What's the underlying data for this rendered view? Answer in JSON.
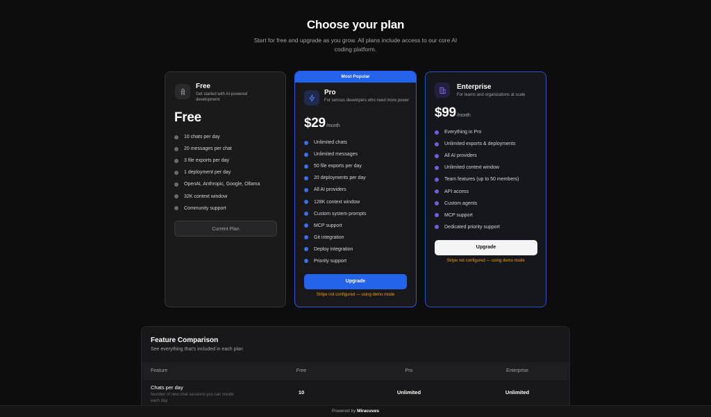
{
  "header": {
    "title": "Choose your plan",
    "subtitle": "Start for free and upgrade as you grow. All plans include access to our core AI coding platform."
  },
  "colors": {
    "accent": "#2563eb",
    "enterprise_accent": "#6d5ce7",
    "warning": "#f59e0b",
    "background": "#0d0d0d"
  },
  "plans": {
    "free": {
      "icon": "rocket-icon",
      "name": "Free",
      "description": "Get started with AI-powered development",
      "price": "Free",
      "features": [
        "10 chats per day",
        "20 messages per chat",
        "3 file exports per day",
        "1 deployment per day",
        "OpenAI, Anthropic, Google, Ollama",
        "32K context window",
        "Community support"
      ],
      "button": "Current Plan"
    },
    "pro": {
      "badge": "Most Popular",
      "icon": "lightning-icon",
      "name": "Pro",
      "description": "For serious developers who need more power",
      "price": "$29",
      "period": "/month",
      "features": [
        "Unlimited chats",
        "Unlimited messages",
        "50 file exports per day",
        "20 deployments per day",
        "All AI providers",
        "128K context window",
        "Custom system prompts",
        "MCP support",
        "Git integration",
        "Deploy integration",
        "Priority support"
      ],
      "button": "Upgrade",
      "note": "Stripe not configured — using demo mode"
    },
    "enterprise": {
      "icon": "building-icon",
      "name": "Enterprise",
      "description": "For teams and organizations at scale",
      "price": "$99",
      "period": "/month",
      "features": [
        "Everything in Pro",
        "Unlimited exports & deployments",
        "All AI providers",
        "Unlimited context window",
        "Team features (up to 50 members)",
        "API access",
        "Custom agents",
        "MCP support",
        "Dedicated priority support"
      ],
      "button": "Upgrade",
      "note": "Stripe not configured — using demo mode"
    }
  },
  "comparison": {
    "title": "Feature Comparison",
    "subtitle": "See everything that's included in each plan",
    "columns": [
      "Feature",
      "Free",
      "Pro",
      "Enterprise"
    ],
    "rows": [
      {
        "feature": "Chats per day",
        "description": "Number of new chat sessions you can create each day",
        "free": "10",
        "pro": "Unlimited",
        "enterprise": "Unlimited"
      }
    ]
  },
  "footer": {
    "prefix": "Powered by",
    "brand": "Miracuves"
  }
}
